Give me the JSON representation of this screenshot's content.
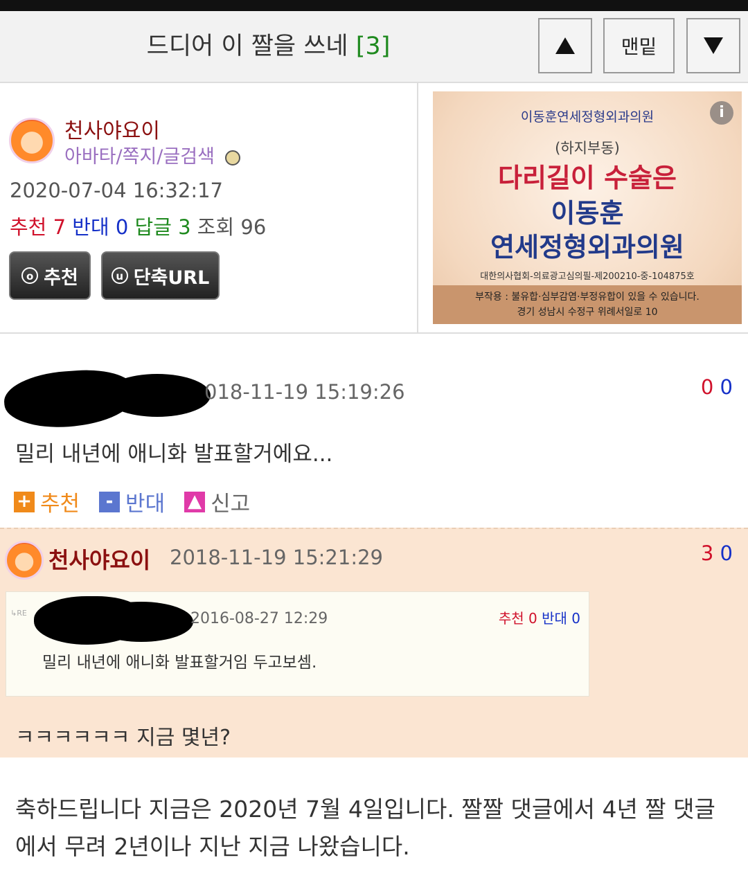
{
  "header": {
    "title": "드디어 이 짤을 쓰네",
    "reply_count": "[3]",
    "up_label": "▲",
    "bottom_label": "맨밑",
    "down_label": "▼"
  },
  "post_info": {
    "author": "천사야요이",
    "author_links": "아바타/쪽지/글검색",
    "datetime": "2020-07-04 16:32:17",
    "stats": {
      "recommend_label": "추천",
      "recommend": "7",
      "oppose_label": "반대",
      "oppose": "0",
      "reply_label": "답글",
      "reply": "3",
      "views_label": "조회",
      "views": "96"
    },
    "buttons": {
      "recommend_icon": "ⓞ",
      "recommend": "추천",
      "shorturl_icon": "ⓤ",
      "shorturl": "단축URL"
    }
  },
  "ad": {
    "clinic": "이동훈연세정형외과의원",
    "info": "i",
    "sub": "(하지부동)",
    "line1": "다리길이 수술은",
    "line2": "이동훈",
    "line3": "연세정형외과의원",
    "registration": "대한의사협회-의료광고심의필-제200210-중-104875호",
    "side_effect": "부작용 : 불유합·심부감염·부정유합이 있을 수 있습니다.",
    "address": "경기 성남시 수정구 위례서일로 10"
  },
  "comment1": {
    "datetime": "018-11-19 15:19:26",
    "votes_up": "0",
    "votes_down": "0",
    "text": "밀리 내년에 애니화 발표할거에요...",
    "actions": {
      "recommend": "추천",
      "oppose": "반대",
      "report": "신고",
      "plus": "+",
      "minus": "-"
    }
  },
  "comment2": {
    "author": "천사야요이",
    "datetime": "2018-11-19 15:21:29",
    "votes_up": "3",
    "votes_down": "0",
    "quote": {
      "re": "RE",
      "datetime": "2016-08-27 12:29",
      "recommend_label": "추천",
      "recommend": "0",
      "oppose_label": "반대",
      "oppose": "0",
      "text": "밀리 내년에 애니화 발표할거임 두고보셈."
    },
    "text": "ㅋㅋㅋㅋㅋㅋ 지금 몇년?"
  },
  "post_body": "축하드립니다 지금은 2020년 7월 4일입니다. 짤짤 댓글에서 4년 짤 댓글에서 무려 2년이나 지난 지금 나왔습니다.",
  "colors": {
    "author": "#8b1010",
    "recommend": "#d0112b",
    "oppose": "#1530c8",
    "reply": "#1f8a1f",
    "highlight_bg": "#fbe5d2"
  }
}
